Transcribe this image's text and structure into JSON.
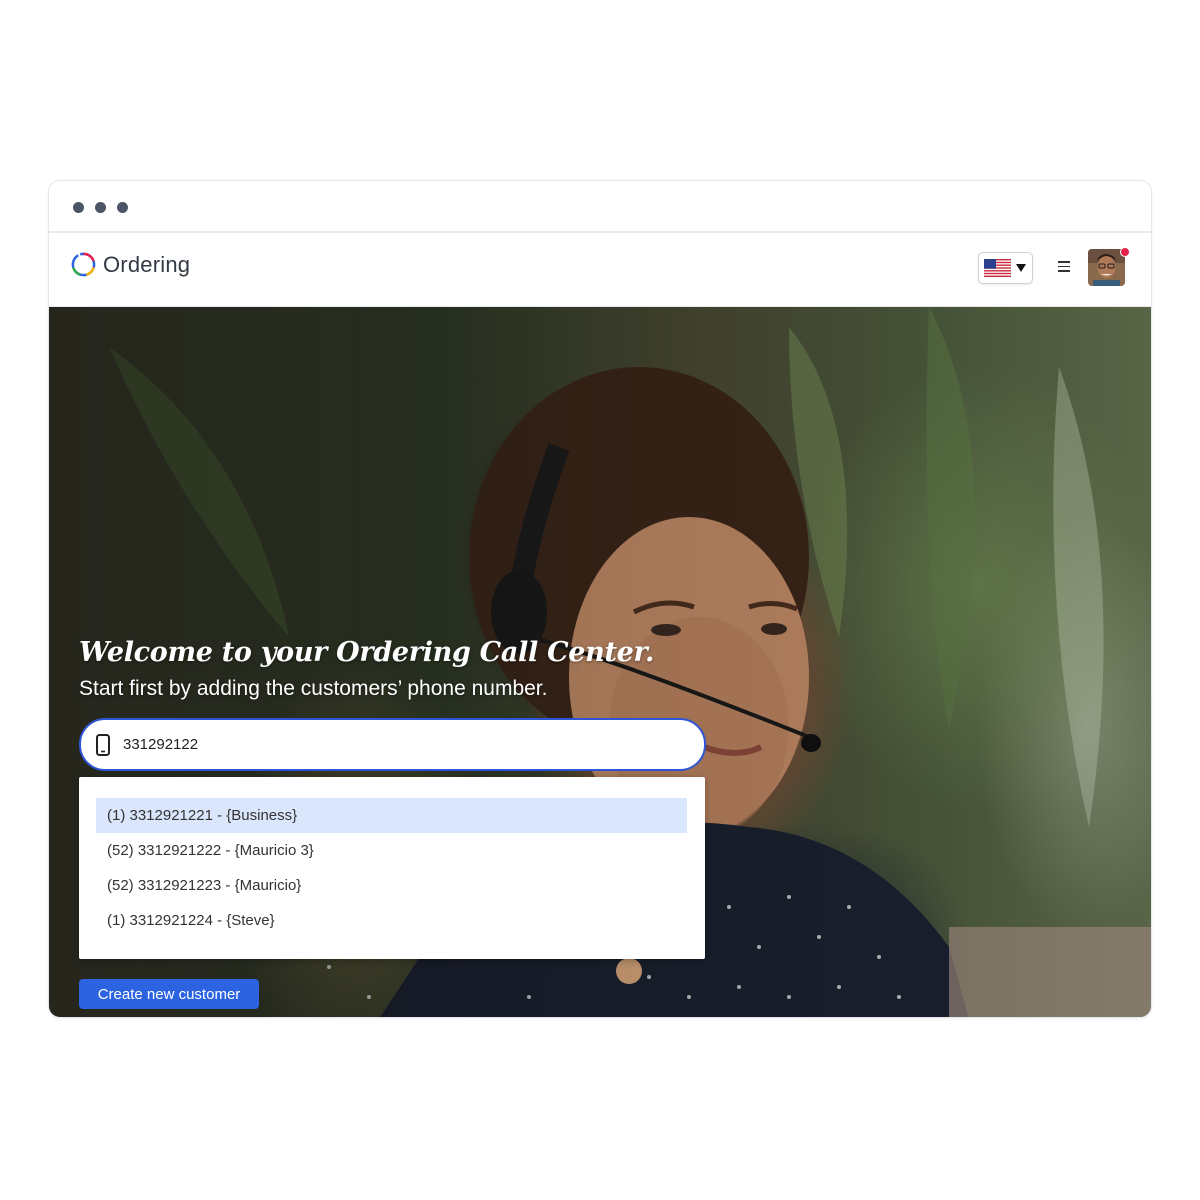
{
  "window": {
    "controls": [
      "dot",
      "dot",
      "dot"
    ]
  },
  "header": {
    "logo_text": "Ordering",
    "language": {
      "flag_icon": "us-flag-icon",
      "caret_icon": "caret-down-icon"
    },
    "menu_icon": "hamburger-menu-icon",
    "avatar": {
      "has_notification": true,
      "badge_color": "#e3204a"
    }
  },
  "hero": {
    "welcome": "Welcome to your Ordering Call Center.",
    "subtitle": "Start first by adding the customers’ phone number.",
    "phone_input": {
      "value": "331292122",
      "icon": "mobile-phone-icon"
    },
    "suggestions": [
      {
        "label": "(1) 3312921221 - {Business}",
        "highlighted": true
      },
      {
        "label": "(52) 3312921222 - {Mauricio 3}",
        "highlighted": false
      },
      {
        "label": "(52) 3312921223 - {Mauricio}",
        "highlighted": false
      },
      {
        "label": "(1) 3312921224 - {Steve}",
        "highlighted": false
      }
    ],
    "create_button": "Create new customer"
  },
  "colors": {
    "accent": "#2c63e0",
    "input_border": "#2e55d6",
    "highlight": "#d9e6fb",
    "logo_ring": [
      "#e3204a",
      "#f4b400",
      "#34a853",
      "#2c63e0"
    ]
  }
}
